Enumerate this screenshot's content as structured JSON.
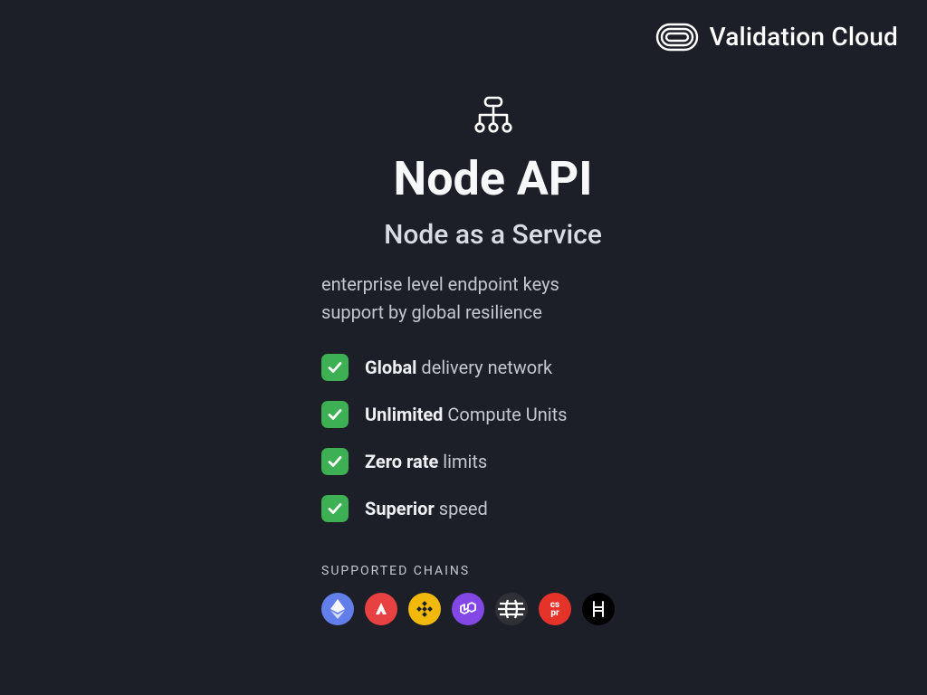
{
  "brand": {
    "name": "Validation Cloud"
  },
  "hero": {
    "title": "Node API",
    "subtitle": "Node as a Service",
    "description_line1": "enterprise level endpoint keys",
    "description_line2": "support by global resilience"
  },
  "features": [
    {
      "bold": "Global",
      "rest": " delivery network"
    },
    {
      "bold": "Unlimited",
      "rest": " Compute Units"
    },
    {
      "bold": "Zero rate",
      "rest": " limits"
    },
    {
      "bold": "Superior",
      "rest": " speed"
    }
  ],
  "chains": {
    "label": "SUPPORTED CHAINS",
    "items": [
      {
        "name": "ethereum",
        "color": "#627eea"
      },
      {
        "name": "avalanche",
        "color": "#e84142"
      },
      {
        "name": "bnb",
        "color": "#f0b90b"
      },
      {
        "name": "polygon",
        "color": "#8247e5"
      },
      {
        "name": "near",
        "color": "#2f3036"
      },
      {
        "name": "casper",
        "color": "#e6332a"
      },
      {
        "name": "hedera",
        "color": "#000000"
      }
    ]
  },
  "colors": {
    "bg": "#1c1f28",
    "check": "#3cb052",
    "text_primary": "#f7f8fa",
    "text_secondary": "#c3c7d0"
  }
}
